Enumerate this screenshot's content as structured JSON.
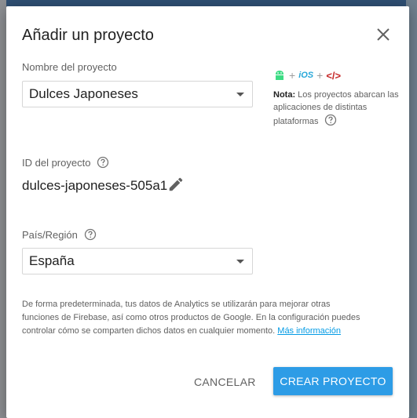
{
  "dialog": {
    "title": "Añadir un proyecto",
    "close_icon": "close-icon"
  },
  "project_name": {
    "label": "Nombre del proyecto",
    "value": "Dulces Japoneses"
  },
  "project_id": {
    "label": "ID del proyecto",
    "value": "dulces-japoneses-505a1",
    "edit_icon": "pencil-icon"
  },
  "region": {
    "label": "País/Región",
    "value": "España"
  },
  "platforms": {
    "ios_label": "iOS",
    "code_label": "</>",
    "plus": "+",
    "note_bold": "Nota:",
    "note_text": " Los proyectos abarcan las aplicaciones de distintas plataformas"
  },
  "disclaimer": {
    "text": "De forma predeterminada, tus datos de Analytics se utilizarán para mejorar otras funciones de Firebase, así como otros productos de Google. En la configuración puedes controlar cómo se comparten dichos datos en cualquier momento. ",
    "link": "Más información"
  },
  "actions": {
    "cancel": "CANCELAR",
    "create": "CREAR PROYECTO"
  },
  "colors": {
    "primary": "#2d9ce6",
    "android": "#3ddc84",
    "ios": "#26a7d9",
    "code": "#c62828",
    "link": "#039be5"
  }
}
